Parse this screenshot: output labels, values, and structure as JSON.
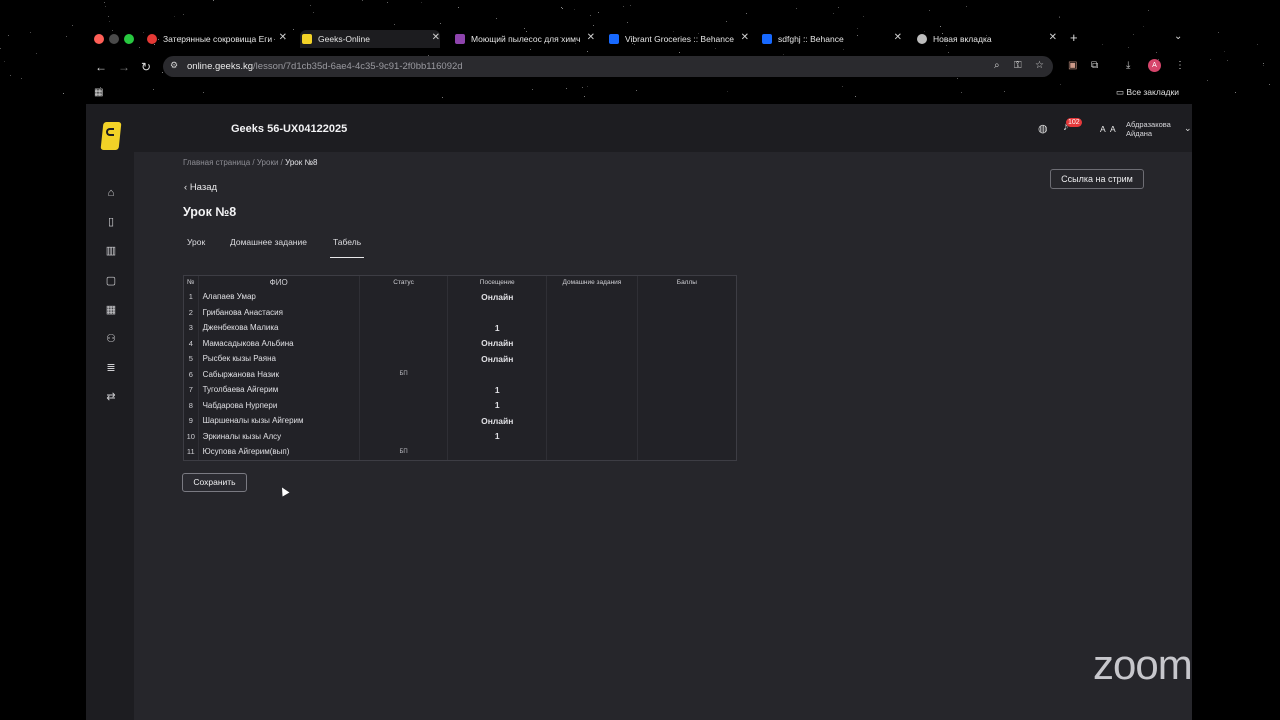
{
  "browser": {
    "tabs": [
      {
        "title": "Затерянные сокровища Еги",
        "favicon_color": "#e53935"
      },
      {
        "title": "Geeks-Online",
        "favicon_color": "#f2d227"
      },
      {
        "title": "Моющий пылесос для химч",
        "favicon_color": "#8e44ad"
      },
      {
        "title": "Vibrant Groceries :: Behance",
        "favicon_color": "#1769ff"
      },
      {
        "title": "sdfghj :: Behance",
        "favicon_color": "#1769ff"
      },
      {
        "title": "Новая вкладка",
        "favicon_color": "#bdbdbd"
      }
    ],
    "url_host": "online.geeks.kg",
    "url_path": "/lesson/7d1cb35d-6ae4-4c35-9c91-2f0bb116092d",
    "bookmarks_label": "Все закладки",
    "profile_initial": "A"
  },
  "header": {
    "group_title": "Geeks 56-UX04122025",
    "notifications_count": "102",
    "avatar_initials": "А А",
    "user_name_line1": "Абдразакова",
    "user_name_line2": "Айдана"
  },
  "page": {
    "breadcrumb": {
      "home": "Главная страница",
      "sep1": " / ",
      "lessons": "Уроки",
      "sep2": " / ",
      "current": "Урок №8"
    },
    "back_label": "Назад",
    "stream_button": "Ссылка на стрим",
    "title": "Урок №8",
    "tabs": [
      {
        "label": "Урок"
      },
      {
        "label": "Домашнее задание"
      },
      {
        "label": "Табель",
        "active": true
      }
    ],
    "table": {
      "headers": {
        "num": "№",
        "name": "ФИО",
        "status": "Статус",
        "attendance": "Посещение",
        "homework": "Домашние задания",
        "score": "Баллы"
      },
      "rows": [
        {
          "num": "1",
          "name": "Алапаев Умар",
          "status": "",
          "attendance": "Онлайн"
        },
        {
          "num": "2",
          "name": "Грибанова Анастасия",
          "status": "",
          "attendance": ""
        },
        {
          "num": "3",
          "name": "Дженбекова Малика",
          "status": "",
          "attendance": "1"
        },
        {
          "num": "4",
          "name": "Мамасадыкова Альбина",
          "status": "",
          "attendance": "Онлайн"
        },
        {
          "num": "5",
          "name": "Рысбек кызы Раяна",
          "status": "",
          "attendance": "Онлайн"
        },
        {
          "num": "6",
          "name": "Сабыржанова Назик",
          "status": "БП",
          "attendance": ""
        },
        {
          "num": "7",
          "name": "Туголбаева Айгерим",
          "status": "",
          "attendance": "1"
        },
        {
          "num": "8",
          "name": "Чабдарова Нурпери",
          "status": "",
          "attendance": "1"
        },
        {
          "num": "9",
          "name": "Шаршеналы кызы Айгерим",
          "status": "",
          "attendance": "Онлайн"
        },
        {
          "num": "10",
          "name": "Эркиналы кызы Алсу",
          "status": "",
          "attendance": "1"
        },
        {
          "num": "11",
          "name": "Юсупова Айгерим(вып)",
          "status": "БП",
          "attendance": ""
        }
      ]
    },
    "save_button": "Сохранить"
  },
  "overlay": {
    "zoom_logo": "zoom"
  },
  "icons": {
    "sidebar": [
      "home-icon",
      "book-icon",
      "open-book-icon",
      "calendar-icon",
      "table-icon",
      "users-icon",
      "list-icon",
      "transfer-icon"
    ]
  }
}
